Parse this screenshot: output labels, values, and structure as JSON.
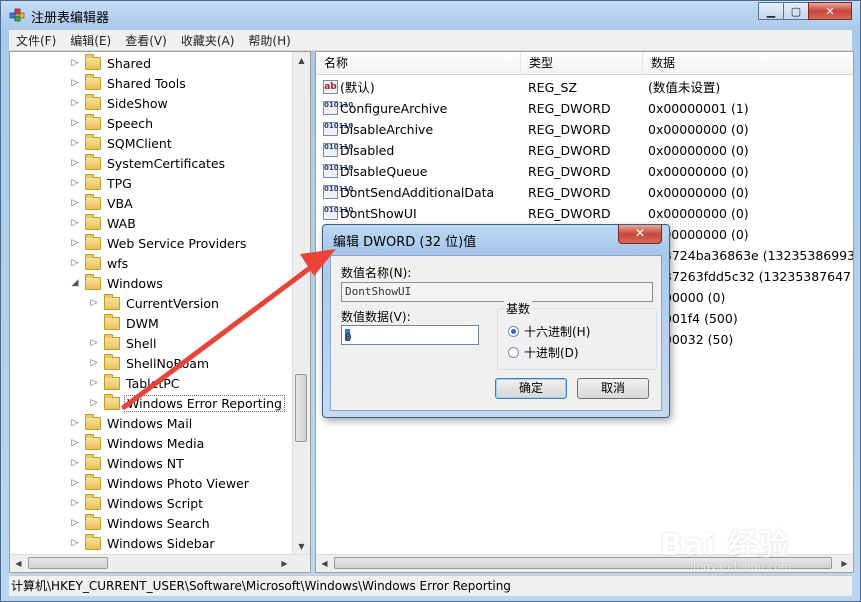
{
  "window": {
    "title": "注册表编辑器"
  },
  "menu": [
    "文件(F)",
    "编辑(E)",
    "查看(V)",
    "收藏夹(A)",
    "帮助(H)"
  ],
  "tree": {
    "items": [
      {
        "label": "Shared",
        "expander": "▷",
        "level": 1
      },
      {
        "label": "Shared Tools",
        "expander": "▷",
        "level": 1
      },
      {
        "label": "SideShow",
        "expander": "▷",
        "level": 1
      },
      {
        "label": "Speech",
        "expander": "▷",
        "level": 1
      },
      {
        "label": "SQMClient",
        "expander": "▷",
        "level": 1
      },
      {
        "label": "SystemCertificates",
        "expander": "▷",
        "level": 1
      },
      {
        "label": "TPG",
        "expander": "▷",
        "level": 1
      },
      {
        "label": "VBA",
        "expander": "▷",
        "level": 1
      },
      {
        "label": "WAB",
        "expander": "▷",
        "level": 1
      },
      {
        "label": "Web Service Providers",
        "expander": "▷",
        "level": 1
      },
      {
        "label": "wfs",
        "expander": "▷",
        "level": 1
      },
      {
        "label": "Windows",
        "expander": "◢",
        "level": 1
      },
      {
        "label": "CurrentVersion",
        "expander": "▷",
        "level": 2
      },
      {
        "label": "DWM",
        "expander": "",
        "level": 2
      },
      {
        "label": "Shell",
        "expander": "▷",
        "level": 2
      },
      {
        "label": "ShellNoRoam",
        "expander": "▷",
        "level": 2
      },
      {
        "label": "TabletPC",
        "expander": "▷",
        "level": 2
      },
      {
        "label": "Windows Error Reporting",
        "expander": "▷",
        "level": 2,
        "selected": true
      },
      {
        "label": "Windows Mail",
        "expander": "▷",
        "level": 1
      },
      {
        "label": "Windows Media",
        "expander": "▷",
        "level": 1
      },
      {
        "label": "Windows NT",
        "expander": "▷",
        "level": 1
      },
      {
        "label": "Windows Photo Viewer",
        "expander": "▷",
        "level": 1
      },
      {
        "label": "Windows Script",
        "expander": "▷",
        "level": 1
      },
      {
        "label": "Windows Search",
        "expander": "▷",
        "level": 1
      },
      {
        "label": "Windows Sidebar",
        "expander": "▷",
        "level": 1
      }
    ]
  },
  "list": {
    "headers": [
      "名称",
      "类型",
      "数据"
    ],
    "rows": [
      {
        "icon": "string-value-icon",
        "name": "(默认)",
        "type": "REG_SZ",
        "data": "(数值未设置)"
      },
      {
        "icon": "dword-value-icon",
        "name": "ConfigureArchive",
        "type": "REG_DWORD",
        "data": "0x00000001 (1)"
      },
      {
        "icon": "dword-value-icon",
        "name": "DisableArchive",
        "type": "REG_DWORD",
        "data": "0x00000000 (0)"
      },
      {
        "icon": "dword-value-icon",
        "name": "Disabled",
        "type": "REG_DWORD",
        "data": "0x00000000 (0)"
      },
      {
        "icon": "dword-value-icon",
        "name": "DisableQueue",
        "type": "REG_DWORD",
        "data": "0x00000000 (0)"
      },
      {
        "icon": "dword-value-icon",
        "name": "DontSendAdditionalData",
        "type": "REG_DWORD",
        "data": "0x00000000 (0)"
      },
      {
        "icon": "dword-value-icon",
        "name": "DontShowUI",
        "type": "REG_DWORD",
        "data": "0x00000000 (0)"
      },
      {
        "icon": "",
        "name": "",
        "type": "",
        "data": "0x00000000 (0)"
      },
      {
        "icon": "",
        "name": "",
        "type": "",
        "data": "d63724ba36863e (13235386993"
      },
      {
        "icon": "",
        "name": "",
        "type": "",
        "data": "d637263fdd5c32 (13235387647"
      },
      {
        "icon": "",
        "name": "",
        "type": "",
        "data": "0000000 (0)"
      },
      {
        "icon": "",
        "name": "",
        "type": "",
        "data": "00001f4 (500)"
      },
      {
        "icon": "",
        "name": "",
        "type": "",
        "data": "0000032 (50)"
      }
    ]
  },
  "statusbar": {
    "path": "计算机\\HKEY_CURRENT_USER\\Software\\Microsoft\\Windows\\Windows Error Reporting"
  },
  "dialog": {
    "title": "编辑 DWORD (32 位)值",
    "close": "✕",
    "name_label": "数值名称(N):",
    "name_value": "DontShowUI",
    "data_label": "数值数据(V):",
    "data_value": "0",
    "base_label": "基数",
    "radio_hex": "十六进制(H)",
    "radio_dec": "十进制(D)",
    "hex_selected": true,
    "ok": "确定",
    "cancel": "取消"
  },
  "watermark": {
    "text": "Bai 经验",
    "sub": "jingyan.baidu.com"
  },
  "colors": {
    "arrow": "#e8443a",
    "selection_border": "#666666",
    "title_bar": "#a9c9ea"
  }
}
